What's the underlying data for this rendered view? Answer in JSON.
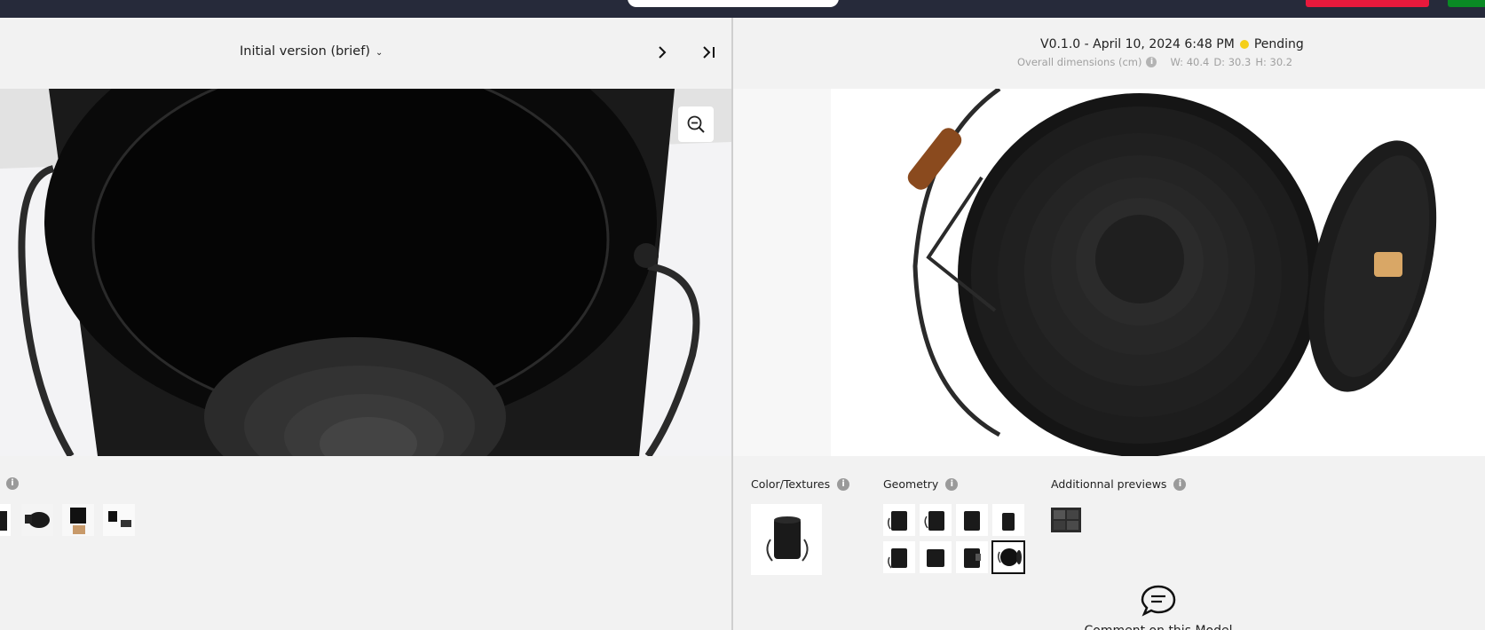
{
  "left": {
    "version_label": "Initial version (brief)",
    "next_label": "›",
    "last_label": "›|",
    "thumbnail_count": 4
  },
  "right": {
    "version_text": "V0.1.0 - April 10, 2024 6:48 PM",
    "status": "Pending",
    "status_color": "#f5cf1a",
    "dims_label": "Overall dimensions (cm)",
    "dims": {
      "w": "W: 40.4",
      "d": "D: 30.3",
      "h": "H: 30.2"
    },
    "sections": {
      "color": "Color/Textures",
      "geometry": "Geometry",
      "additional": "Additionnal previews"
    },
    "geometry_selected_index": 7,
    "chat_text": "Comment on this Model"
  },
  "icons": {
    "zoom": "zoom-out-icon",
    "info": "info-icon",
    "chat": "chat-bubble-icon"
  },
  "colors": {
    "topbar": "#262a3a",
    "accent_red": "#e8193c",
    "accent_green": "#0a8a24"
  }
}
